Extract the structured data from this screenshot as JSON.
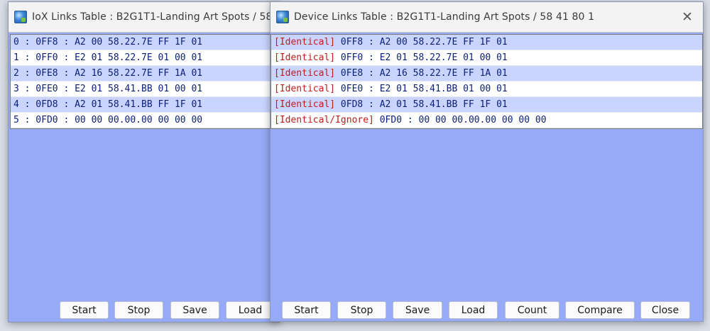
{
  "left_window": {
    "title": "IoX Links Table : B2G1T1-Landing Art Spots / 58 41",
    "rows": [
      "0 : 0FF8 : A2 00 58.22.7E FF 1F 01",
      "1 : 0FF0 : E2 01 58.22.7E 01 00 01",
      "2 : 0FE8 : A2 16 58.22.7E FF 1A 01",
      "3 : 0FE0 : E2 01 58.41.BB 01 00 01",
      "4 : 0FD8 : A2 01 58.41.BB FF 1F 01",
      "5 : 0FD0 : 00 00 00.00.00 00 00 00"
    ],
    "buttons": {
      "start": "Start",
      "stop": "Stop",
      "save": "Save",
      "load": "Load"
    }
  },
  "right_window": {
    "title": "Device Links Table : B2G1T1-Landing Art Spots / 58 41 80 1",
    "close_glyph": "✕",
    "rows": [
      {
        "tag": "[Identical]",
        "text": " 0FF8 : A2 00 58.22.7E FF 1F 01"
      },
      {
        "tag": "[Identical]",
        "text": " 0FF0 : E2 01 58.22.7E 01 00 01"
      },
      {
        "tag": "[Identical]",
        "text": " 0FE8 : A2 16 58.22.7E FF 1A 01"
      },
      {
        "tag": "[Identical]",
        "text": " 0FE0 : E2 01 58.41.BB 01 00 01"
      },
      {
        "tag": "[Identical]",
        "text": " 0FD8 : A2 01 58.41.BB FF 1F 01"
      },
      {
        "tag": "[Identical/Ignore]",
        "text": " 0FD0 : 00 00 00.00.00 00 00 00"
      }
    ],
    "buttons": {
      "start": "Start",
      "stop": "Stop",
      "save": "Save",
      "load": "Load",
      "count": "Count",
      "compare": "Compare",
      "close": "Close"
    }
  },
  "colors": {
    "window_body": "#96aaf7",
    "row_highlight": "#c9d5ff",
    "status_tag": "#c41a1a",
    "row_text": "#0b1f7a"
  }
}
